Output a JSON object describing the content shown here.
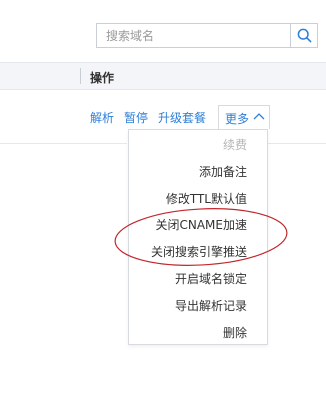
{
  "search": {
    "placeholder": "搜索域名",
    "value": ""
  },
  "table": {
    "header_ops_label": "操作"
  },
  "row_actions": {
    "resolve_label": "解析",
    "pause_label": "暂停",
    "upgrade_label": "升级套餐",
    "more_label": "更多"
  },
  "more_menu": {
    "items": [
      {
        "label": "续费",
        "disabled": true
      },
      {
        "label": "添加备注",
        "disabled": false
      },
      {
        "label": "修改TTL默认值",
        "disabled": false
      },
      {
        "label": "关闭CNAME加速",
        "disabled": false
      },
      {
        "label": "关闭搜索引擎推送",
        "disabled": false
      },
      {
        "label": "开启域名锁定",
        "disabled": false
      },
      {
        "label": "导出解析记录",
        "disabled": false
      },
      {
        "label": "删除",
        "disabled": false
      }
    ]
  },
  "colors": {
    "link": "#2e7fd8",
    "annotation": "#c1272d",
    "header_bg": "#f4f5f8",
    "disabled_text": "#b4b4b4"
  },
  "icons": {
    "search": "search-icon",
    "chevron": "chevron-up-icon"
  }
}
